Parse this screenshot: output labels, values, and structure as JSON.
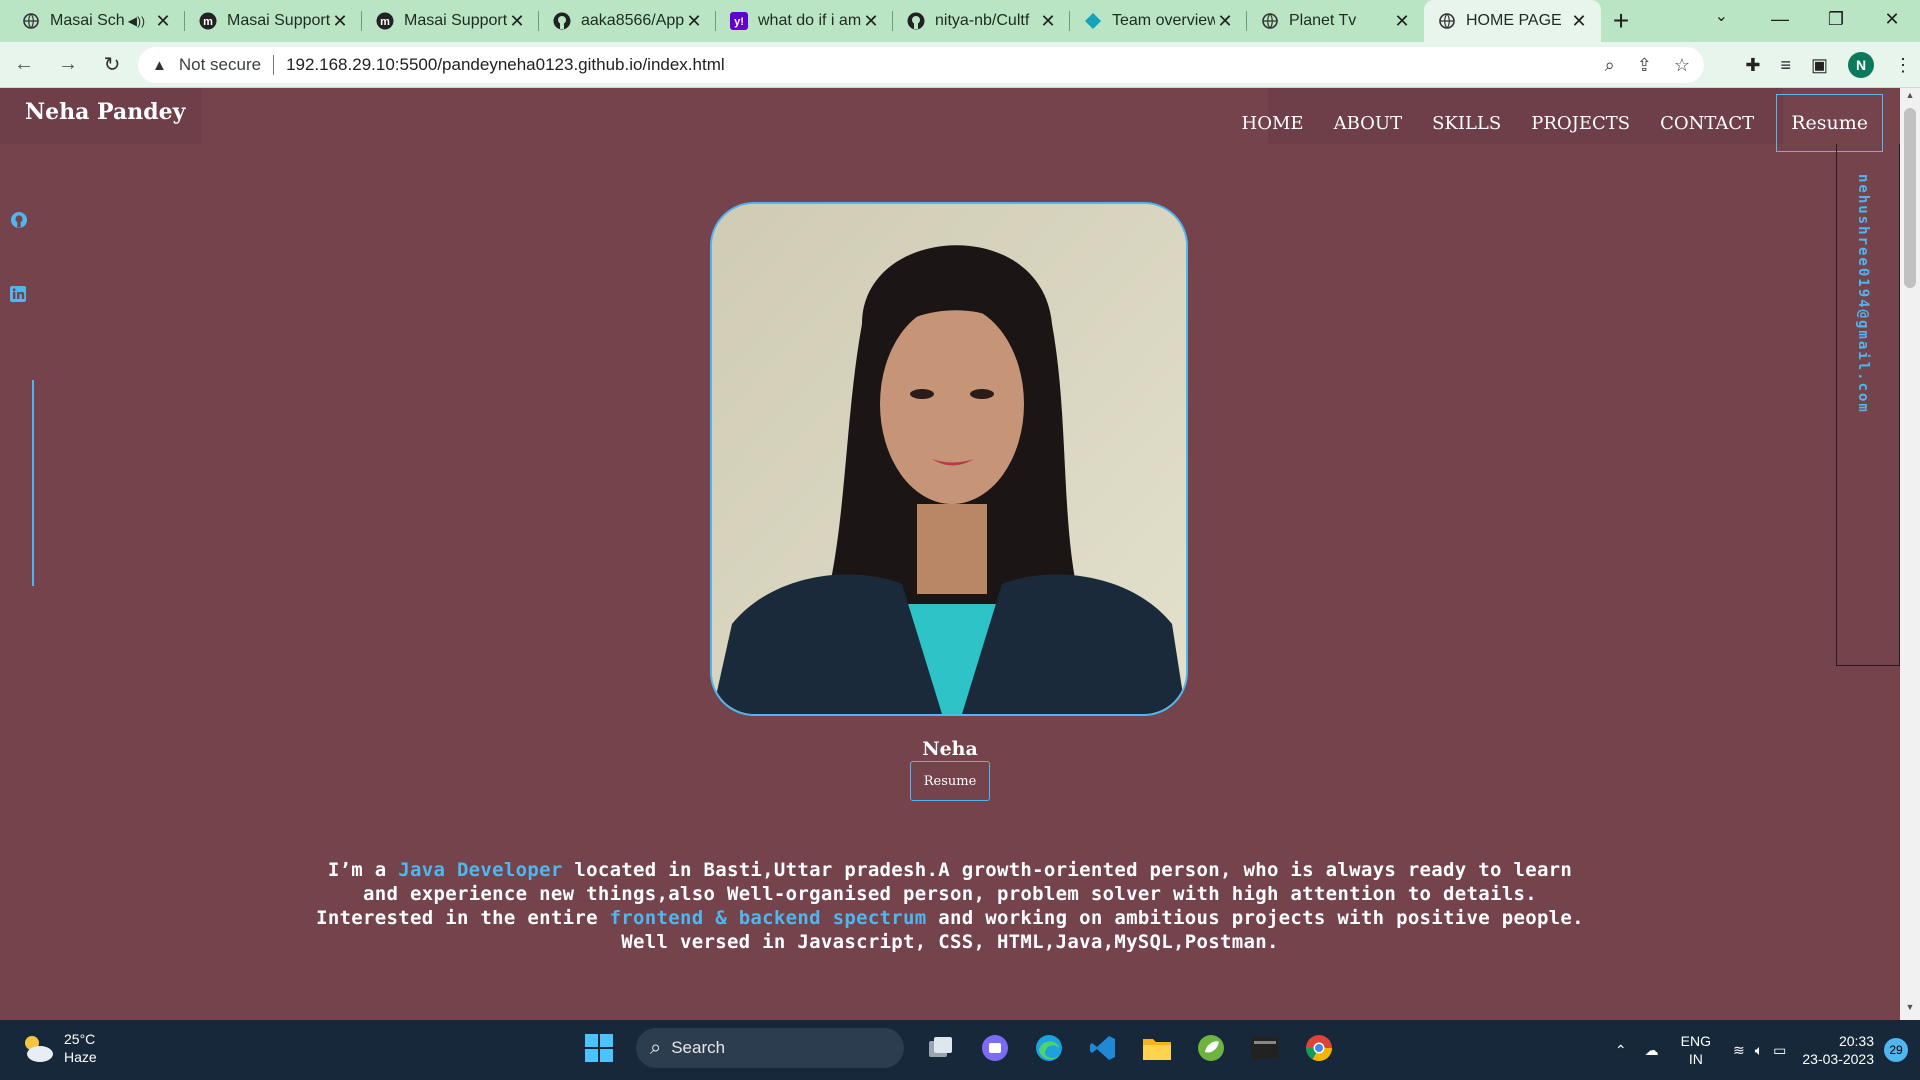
{
  "browser": {
    "tabs": [
      {
        "title": "Masai Sch",
        "favicon": "globe-icon",
        "muted": true
      },
      {
        "title": "Masai Support",
        "favicon": "masai-icon"
      },
      {
        "title": "Masai Support",
        "favicon": "masai-icon"
      },
      {
        "title": "aaka8566/App",
        "favicon": "github-icon"
      },
      {
        "title": "what do if i am",
        "favicon": "yahoo-icon"
      },
      {
        "title": "nitya-nb/Cultf",
        "favicon": "github-icon"
      },
      {
        "title": "Team overview",
        "favicon": "diamond-icon"
      },
      {
        "title": "Planet Tv",
        "favicon": "globe-icon"
      },
      {
        "title": "HOME PAGE",
        "favicon": "globe-icon",
        "active": true
      }
    ],
    "security_label": "Not secure",
    "url": "192.168.29.10:5500/pandeyneha0123.github.io/index.html",
    "profile_initial": "N"
  },
  "site": {
    "brand": "Neha Pandey",
    "nav": [
      "HOME",
      "ABOUT",
      "SKILLS",
      "PROJECTS",
      "CONTACT"
    ],
    "nav_resume": "Resume",
    "email": "nehushree0194@gmail.com",
    "name": "Neha",
    "resume_button": "Resume",
    "about": {
      "p1": "I’m a ",
      "h1": "Java Developer",
      "p2": " located in Basti,Uttar pradesh.A growth-oriented person, who is always ready to learn and experience new things,also Well-organised person, problem solver with high attention to details. Interested in the entire ",
      "h2": "frontend & backend spectrum",
      "p3": " and working on ambitious projects with positive people. Well versed in Javascript, CSS, HTML,Java,MySQL,Postman."
    },
    "colors": {
      "background": "#74434c",
      "accent": "#4fb6f0"
    }
  },
  "taskbar": {
    "temperature": "25°C",
    "condition": "Haze",
    "search_label": "Search",
    "lang_top": "ENG",
    "lang_bottom": "IN",
    "time": "20:33",
    "date": "23-03-2023",
    "notifications": "29"
  }
}
